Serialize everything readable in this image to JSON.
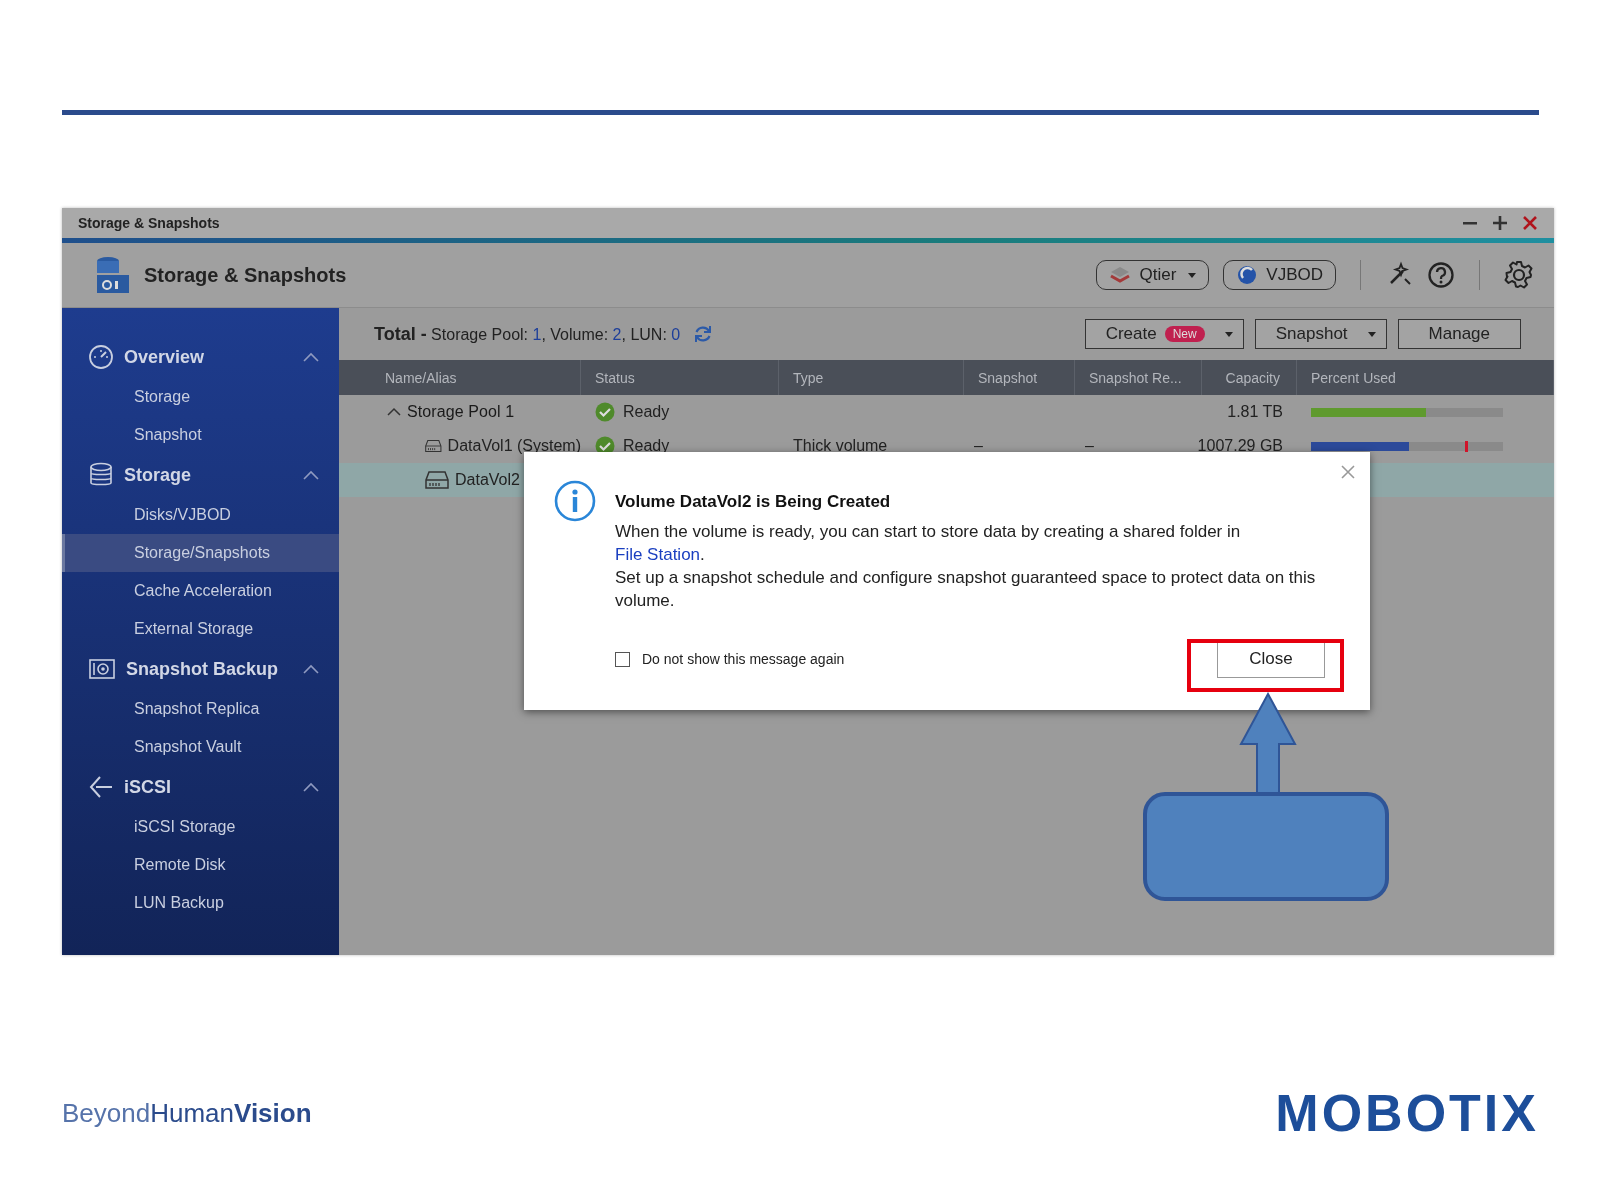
{
  "window": {
    "title": "Storage & Snapshots"
  },
  "header": {
    "title": "Storage & Snapshots",
    "buttons": [
      {
        "label": "Qtier",
        "dropdown": true
      },
      {
        "label": "VJBOD",
        "dropdown": false
      }
    ]
  },
  "sidebar": {
    "groups": [
      {
        "label": "Overview",
        "kind": "overview",
        "expanded": true,
        "items": [
          {
            "label": "Storage",
            "selected": false
          },
          {
            "label": "Snapshot",
            "selected": false
          }
        ]
      },
      {
        "label": "Storage",
        "kind": "storage",
        "expanded": true,
        "items": [
          {
            "label": "Disks/VJBOD",
            "selected": false
          },
          {
            "label": "Storage/Snapshots",
            "selected": true
          },
          {
            "label": "Cache Acceleration",
            "selected": false
          },
          {
            "label": "External Storage",
            "selected": false
          }
        ]
      },
      {
        "label": "Snapshot Backup",
        "kind": "backup",
        "expanded": true,
        "items": [
          {
            "label": "Snapshot Replica",
            "selected": false
          },
          {
            "label": "Snapshot Vault",
            "selected": false
          }
        ]
      },
      {
        "label": "iSCSI",
        "kind": "iscsi",
        "expanded": true,
        "items": [
          {
            "label": "iSCSI Storage",
            "selected": false
          },
          {
            "label": "Remote Disk",
            "selected": false
          },
          {
            "label": "LUN Backup",
            "selected": false
          }
        ]
      }
    ]
  },
  "summary": {
    "label": "Total -",
    "counts": [
      {
        "label": "Storage Pool:",
        "value": "1",
        "separator": ","
      },
      {
        "label": "Volume:",
        "value": "2",
        "separator": ","
      },
      {
        "label": "LUN:",
        "value": "0"
      }
    ]
  },
  "toolbar": [
    {
      "label": "Create",
      "badge": "New",
      "dropdown": true
    },
    {
      "label": "Snapshot",
      "dropdown": true
    },
    {
      "label": "Manage",
      "dropdown": false
    }
  ],
  "table": {
    "columns": [
      "Name/Alias",
      "Status",
      "Type",
      "Snapshot",
      "Snapshot Re...",
      "Capacity",
      "Percent Used"
    ],
    "rows": [
      {
        "name": "Storage Pool 1",
        "kind": "pool",
        "expanded": true,
        "selected": false,
        "status": "Ready",
        "capacity": "1.81 TB",
        "usage": {
          "level": 0.6,
          "color": "#5f9a2e"
        },
        "children": [
          {
            "name": "DataVol1 (System)",
            "kind": "volume",
            "selected": false,
            "status": "Ready",
            "type": "Thick volume",
            "snapshot": "–",
            "snapshot_replica": "–",
            "capacity": "1007.29 GB",
            "usage": {
              "level": 0.51,
              "color": "#2c4a9a",
              "alert_marker": true
            }
          },
          {
            "name": "DataVol2",
            "kind": "volume",
            "selected": true
          }
        ]
      }
    ]
  },
  "dialog": {
    "title": "Volume DataVol2 is Being Created",
    "paragraphs": [
      {
        "text": "When the volume is ready, you can start to store data by creating a shared folder in ",
        "link": "File Station",
        "after": "."
      },
      {
        "text": "Set up a snapshot schedule and configure snapshot guaranteed space to protect data on this volume."
      }
    ],
    "checkbox": {
      "label": "Do not show this message again",
      "checked": false
    },
    "button": "Close"
  },
  "footer": {
    "tagline": [
      {
        "text": "Beyond",
        "kind": "light"
      },
      {
        "text": "Human",
        "kind": "regular"
      },
      {
        "text": "Vision",
        "kind": "bold"
      }
    ],
    "logo": "MOBOTIX"
  }
}
